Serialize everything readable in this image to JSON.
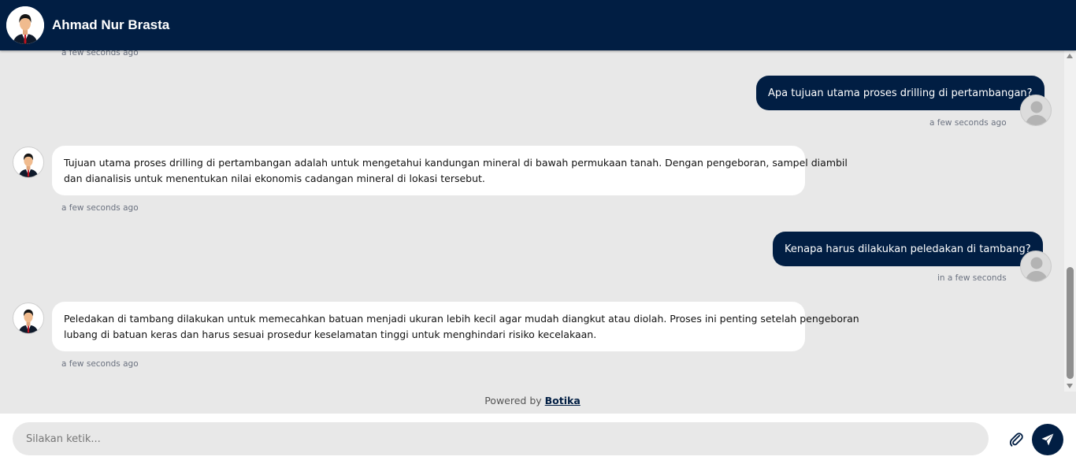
{
  "header": {
    "title": "Ahmad Nur Brasta",
    "avatar_icon": "businessman-avatar-icon"
  },
  "colors": {
    "primary": "#011e43",
    "chat_background": "#e8e8e8",
    "bot_bubble": "#ffffff",
    "user_bubble": "#011e43"
  },
  "chat": {
    "top_partial_timestamp": "a few seconds ago",
    "messages": [
      {
        "sender": "user",
        "text": "Apa tujuan utama proses drilling di pertambangan?",
        "time": "a few seconds ago"
      },
      {
        "sender": "bot",
        "lines": [
          "Tujuan utama proses drilling di pertambangan adalah untuk mengetahui kandungan mineral di bawah permukaan tanah. Dengan pengeboran, sampel diambil",
          "dan dianalisis untuk menentukan nilai ekonomis cadangan mineral di lokasi tersebut."
        ],
        "time": "a few seconds ago"
      },
      {
        "sender": "user",
        "text": "Kenapa harus dilakukan peledakan di tambang?",
        "time": "in a few seconds"
      },
      {
        "sender": "bot",
        "lines": [
          "Peledakan di tambang dilakukan untuk memecahkan batuan menjadi ukuran lebih kecil agar mudah diangkut atau diolah. Proses ini penting setelah pengeboran",
          "lubang di batuan keras dan harus sesuai prosedur keselamatan tinggi untuk menghindari risiko kecelakaan."
        ],
        "time": "a few seconds ago"
      }
    ]
  },
  "powered_by": {
    "prefix": "Powered by",
    "brand": "Botika"
  },
  "composer": {
    "placeholder": "Silakan ketik...",
    "attach_icon": "paperclip-icon",
    "send_icon": "send-icon"
  }
}
